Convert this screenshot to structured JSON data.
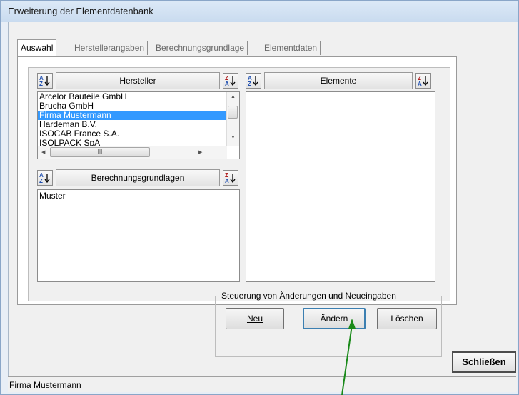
{
  "window": {
    "title": "Erweiterung der Elementdatenbank"
  },
  "tabs": [
    {
      "label": "Auswahl",
      "active": true
    },
    {
      "label": "Herstellerangaben",
      "active": false
    },
    {
      "label": "Berechnungsgrundlage",
      "active": false
    },
    {
      "label": "Elementdaten",
      "active": false
    }
  ],
  "hersteller": {
    "header": "Hersteller",
    "items": [
      "Arcelor Bauteile GmbH",
      "Brucha GmbH",
      "Firma Mustermann",
      "Hardeman B.V.",
      "ISOCAB France S.A.",
      "ISOLPACK SpA"
    ],
    "selected_index": 2,
    "hscroll_dots": "III"
  },
  "berechnungsgrundlagen": {
    "header": "Berechnungsgrundlagen",
    "items": [
      "Muster"
    ]
  },
  "elemente": {
    "header": "Elemente",
    "items": []
  },
  "actions": {
    "legend": "Steuerung von Änderungen und Neueingaben",
    "new_label": "Neu",
    "edit_label": "Ändern",
    "delete_label": "Löschen"
  },
  "close_label": "Schließen",
  "status": "Firma Mustermann",
  "colors": {
    "selection": "#3399ff",
    "annotation_arrow": "#1a8a1a"
  }
}
